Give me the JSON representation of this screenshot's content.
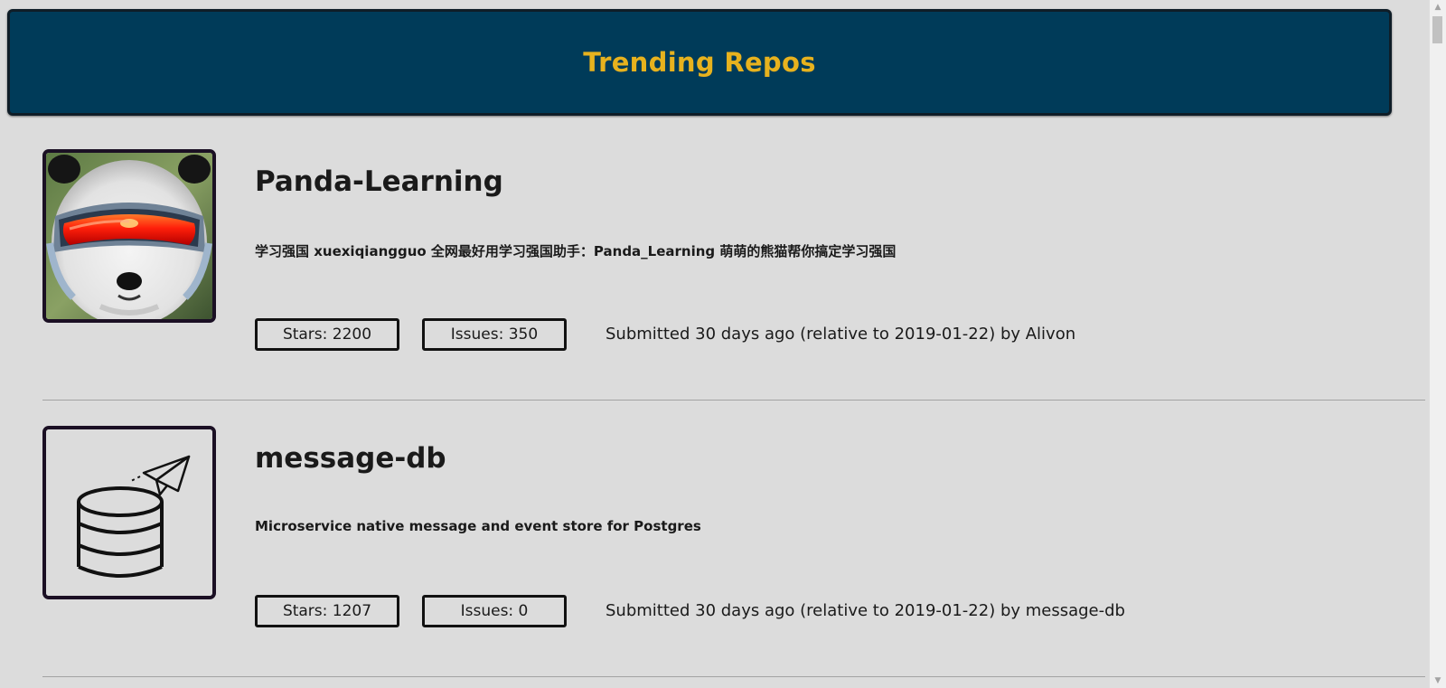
{
  "header": {
    "title": "Trending Repos"
  },
  "repos": [
    {
      "name": "Panda-Learning",
      "description": "学习强国 xuexiqiangguo 全网最好用学习强国助手：Panda_Learning 萌萌的熊猫帮你搞定学习强国",
      "stars_label": "Stars: 2200",
      "issues_label": "Issues: 350",
      "submitted": "Submitted 30 days ago (relative to 2019-01-22) by Alivon",
      "avatar_icon": "panda-goggles-avatar"
    },
    {
      "name": "message-db",
      "description": "Microservice native message and event store for Postgres",
      "stars_label": "Stars: 1207",
      "issues_label": "Issues: 0",
      "submitted": "Submitted 30 days ago (relative to 2019-01-22) by message-db",
      "avatar_icon": "database-paper-plane-icon"
    }
  ],
  "colors": {
    "header_bg": "#003b59",
    "header_text": "#e7b21e",
    "page_bg": "#dcdcdc"
  }
}
